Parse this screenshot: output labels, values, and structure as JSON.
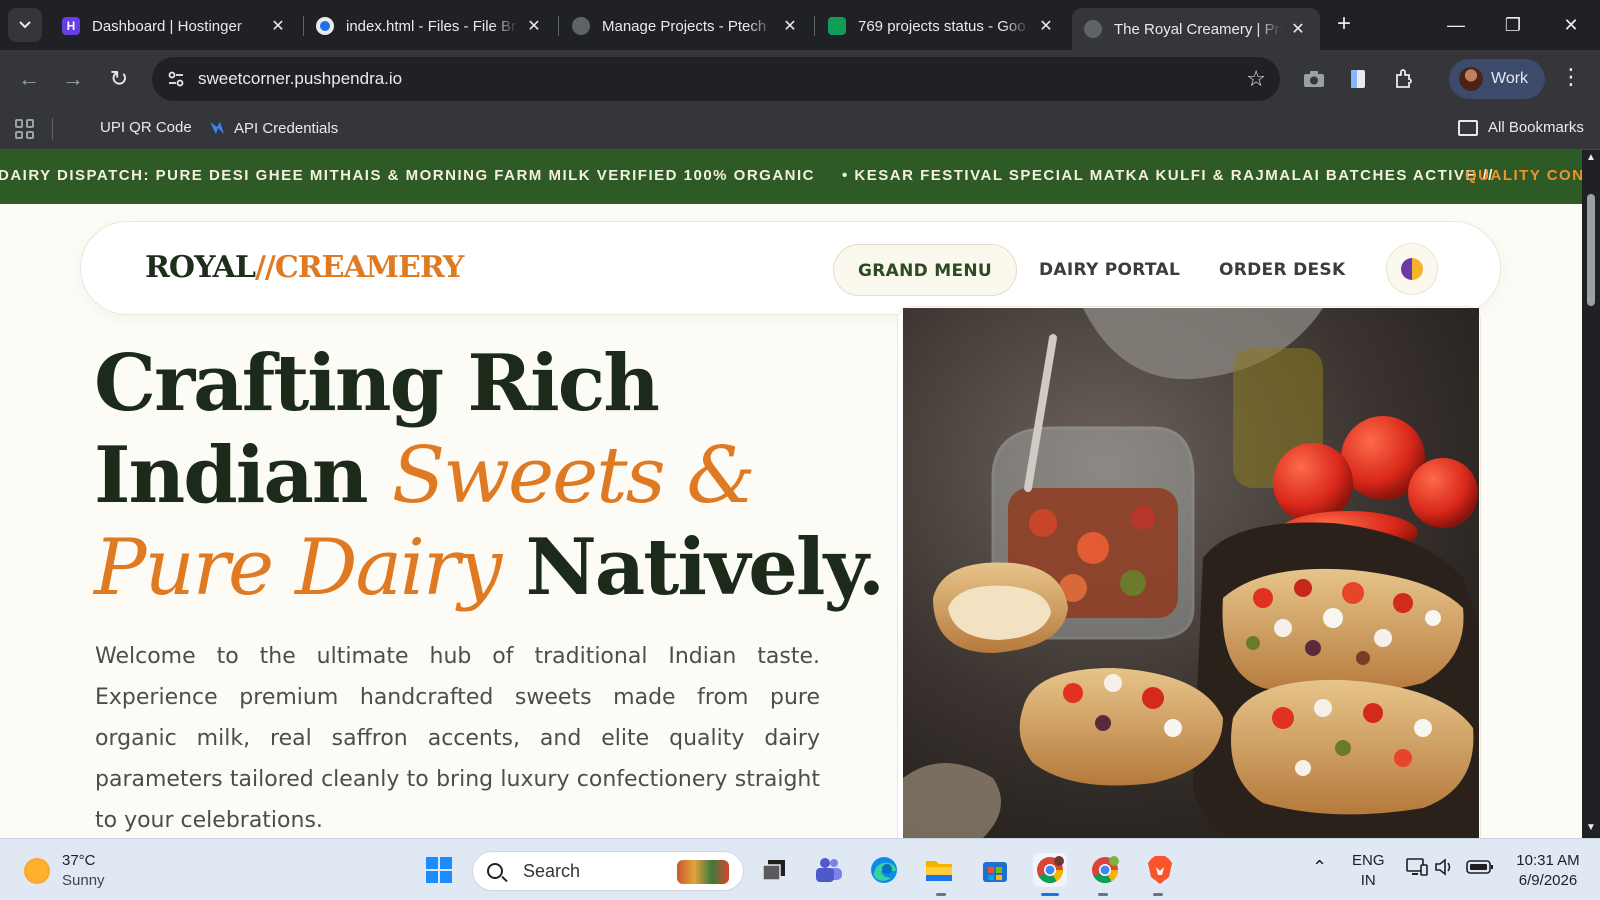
{
  "browser": {
    "tabs": [
      {
        "title": "Dashboard | Hostinger",
        "icon": "hostinger-icon",
        "active": false
      },
      {
        "title": "index.html - Files - File Br",
        "icon": "file-manager-icon",
        "active": false
      },
      {
        "title": "Manage Projects - Ptech",
        "icon": "globe-icon",
        "active": false
      },
      {
        "title": "769 projects status - Goo",
        "icon": "sheets-icon",
        "active": false
      },
      {
        "title": "The Royal Creamery | Pre",
        "icon": "globe-icon",
        "active": true
      }
    ],
    "url": "sweetcorner.pushpendra.io",
    "profile_label": "Work",
    "bookmarks": [
      {
        "label": "UPI QR Code"
      },
      {
        "label": "API Credentials"
      }
    ],
    "all_bookmarks_label": "All Bookmarks"
  },
  "page": {
    "ticker": {
      "part1": "DAIRY DISPATCH: PURE DESI GHEE MITHAIS & MORNING FARM MILK VERIFIED 100% ORGANIC",
      "part2": "• KESAR FESTIVAL SPECIAL MATKA KULFI & RAJMALAI BATCHES ACTIVE //",
      "part3": "QUALITY CON"
    },
    "logo": {
      "left": "ROYAL",
      "right": "//CREAMERY"
    },
    "nav": [
      {
        "label": "GRAND MENU",
        "active": true
      },
      {
        "label": "DAIRY PORTAL",
        "active": false
      },
      {
        "label": "ORDER DESK",
        "active": false
      }
    ],
    "hero": {
      "line1": "Crafting Rich",
      "line2_plain": "Indian ",
      "line2_accent": "Sweets &",
      "line3_accent": "Pure Dairy",
      "line3_plain": " Natively.",
      "body": "Welcome to the ultimate hub of traditional Indian taste. Experience premium handcrafted sweets made from pure organic milk, real saffron accents, and elite quality dairy parameters tailored cleanly to bring luxury confectionery straight to your celebrations."
    },
    "colors": {
      "accent": "#e07a22",
      "dark_green": "#1c2a19",
      "ticker_bg": "#2e5b25"
    }
  },
  "taskbar": {
    "weather": {
      "temp": "37°C",
      "condition": "Sunny"
    },
    "search_placeholder": "Search",
    "lang": {
      "top": "ENG",
      "bottom": "IN"
    },
    "clock": {
      "time": "10:31 AM",
      "date": "6/9/2026"
    }
  }
}
